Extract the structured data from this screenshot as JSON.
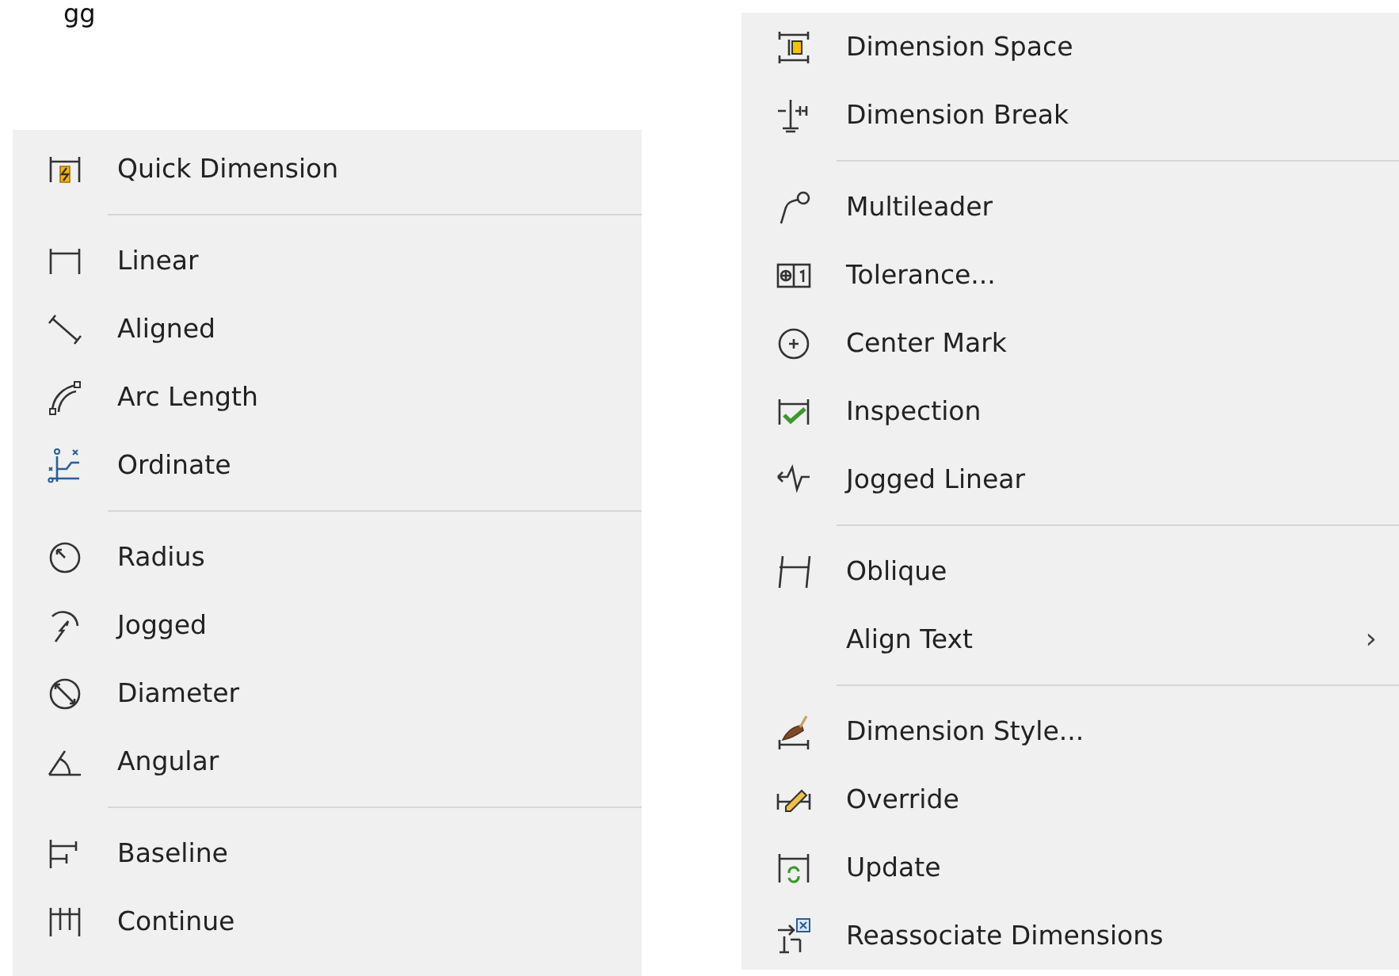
{
  "caption_fragment": "gg",
  "menus": [
    {
      "items": [
        {
          "kind": "item",
          "label": "Quick Dimension"
        },
        {
          "kind": "separator"
        },
        {
          "kind": "item",
          "label": "Linear"
        },
        {
          "kind": "item",
          "label": "Aligned"
        },
        {
          "kind": "item",
          "label": "Arc Length"
        },
        {
          "kind": "item",
          "label": "Ordinate"
        },
        {
          "kind": "separator"
        },
        {
          "kind": "item",
          "label": "Radius"
        },
        {
          "kind": "item",
          "label": "Jogged"
        },
        {
          "kind": "item",
          "label": "Diameter"
        },
        {
          "kind": "item",
          "label": "Angular"
        },
        {
          "kind": "separator"
        },
        {
          "kind": "item",
          "label": "Baseline"
        },
        {
          "kind": "item",
          "label": "Continue"
        }
      ]
    },
    {
      "items": [
        {
          "kind": "item",
          "label": "Dimension Space"
        },
        {
          "kind": "item",
          "label": "Dimension Break"
        },
        {
          "kind": "separator"
        },
        {
          "kind": "item",
          "label": "Multileader"
        },
        {
          "kind": "item",
          "label": "Tolerance..."
        },
        {
          "kind": "item",
          "label": "Center Mark"
        },
        {
          "kind": "item",
          "label": "Inspection"
        },
        {
          "kind": "item",
          "label": "Jogged Linear"
        },
        {
          "kind": "separator"
        },
        {
          "kind": "item",
          "label": "Oblique"
        },
        {
          "kind": "submenu",
          "label": "Align Text",
          "arrow": "›"
        },
        {
          "kind": "separator"
        },
        {
          "kind": "item",
          "label": "Dimension Style..."
        },
        {
          "kind": "item",
          "label": "Override"
        },
        {
          "kind": "item",
          "label": "Update"
        },
        {
          "kind": "item",
          "label": "Reassociate Dimensions"
        }
      ]
    }
  ]
}
